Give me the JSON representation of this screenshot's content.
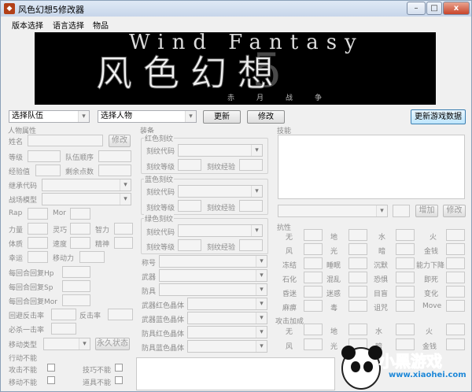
{
  "window": {
    "title": "风色幻想5修改器",
    "app_icon": "app-icon",
    "controls": [
      "–",
      "□",
      "x"
    ]
  },
  "menu": [
    "版本选择",
    "语言选择",
    "物品"
  ],
  "banner": {
    "title_en": "Wind Fantasy",
    "title_cn": "风色幻想",
    "number": "5",
    "subtitle": "赤月战争"
  },
  "toolbar": {
    "team_select": "选择队伍",
    "char_select": "选择人物",
    "refresh": "更新",
    "modify": "修改",
    "update_data": "更新游戏数据"
  },
  "char_attr": {
    "title": "人物属性",
    "name_label": "姓名",
    "modify": "修改",
    "level": "等级",
    "team_order": "队伍顺序",
    "exp": "经验值",
    "points": "剩余点数",
    "inherit_code": "继承代码",
    "battle_model": "战场模型",
    "rap": "Rap",
    "mor": "Mor",
    "stats": [
      [
        "力量",
        "灵巧",
        "智力"
      ],
      [
        "体质",
        "速度",
        "精神"
      ]
    ],
    "luck": "幸运",
    "move": "移动力",
    "hp_regen": "每回合回复Hp",
    "sp_regen": "每回合回复Sp",
    "mor_regen": "每回合回复Mor",
    "counter": "回避反击率",
    "counter2": "反击率",
    "crit": "必杀一击率",
    "move_type": "移动类型",
    "permanent": "永久状态",
    "action_disable": "行动不能",
    "disables": [
      [
        "攻击不能",
        "技巧不能"
      ],
      [
        "移动不能",
        "道具不能"
      ]
    ]
  },
  "equipment": {
    "title": "装备",
    "groups": [
      {
        "title": "红色刻纹",
        "code": "刻纹代码",
        "level": "刻纹等级",
        "exp": "刻纹经验"
      },
      {
        "title": "蓝色刻纹",
        "code": "刻纹代码",
        "level": "刻纹等级",
        "exp": "刻纹经验"
      },
      {
        "title": "绿色刻纹",
        "code": "刻纹代码",
        "level": "刻纹等级",
        "exp": "刻纹经验"
      }
    ],
    "slots": [
      "称号",
      "武器",
      "防具",
      "武器红色晶体",
      "武器蓝色晶体",
      "防具红色晶体",
      "防具蓝色晶体"
    ]
  },
  "skills": {
    "title": "技能",
    "add": "增加",
    "modify": "修改"
  },
  "resist": {
    "title": "抗性",
    "cells": [
      [
        "无",
        "地",
        "水",
        "火"
      ],
      [
        "风",
        "光",
        "暗",
        "金钱"
      ],
      [
        "冻结",
        "睡眠",
        "沉默",
        "能力下降"
      ],
      [
        "石化",
        "混乱",
        "恐惧",
        "即死"
      ],
      [
        "昏迷",
        "迷惑",
        "目盲",
        "变化"
      ],
      [
        "麻痹",
        "毒",
        "诅咒",
        "Move"
      ]
    ]
  },
  "attack_bonus": {
    "title": "攻击加成",
    "cells": [
      [
        "无",
        "地",
        "水",
        "火"
      ],
      [
        "风",
        "光",
        "暗",
        "金钱"
      ]
    ]
  },
  "watermark": {
    "brand": "小黑游戏",
    "site": "www.xiaohei.com"
  }
}
